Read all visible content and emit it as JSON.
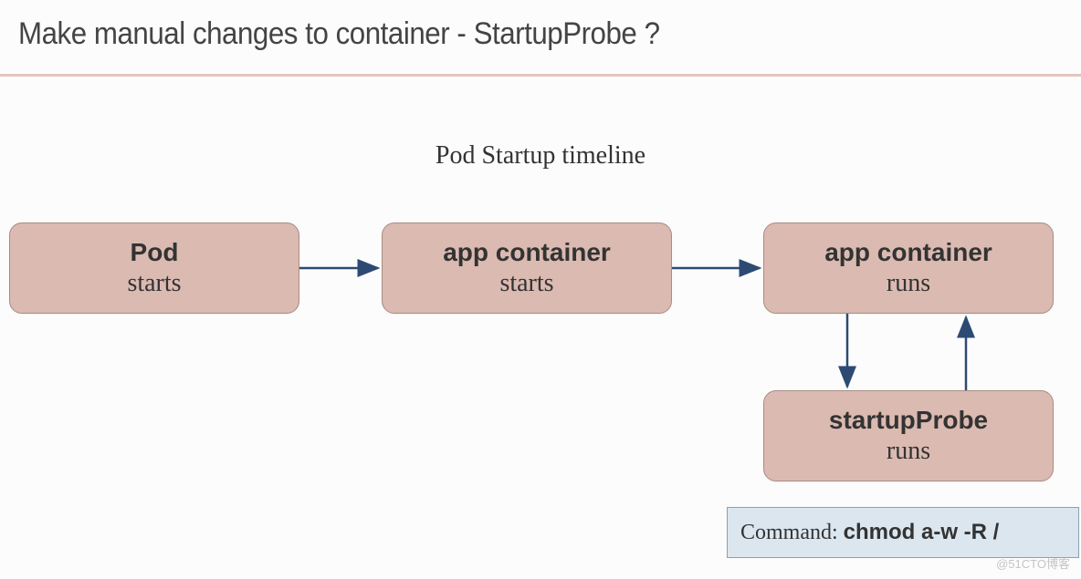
{
  "header": {
    "title": "Make manual changes to container - StartupProbe ?"
  },
  "subtitle": "Pod Startup timeline",
  "boxes": {
    "pod": {
      "title": "Pod",
      "sub": "starts"
    },
    "app1": {
      "title": "app container",
      "sub": "starts"
    },
    "app2": {
      "title": "app container",
      "sub": "runs"
    },
    "probe": {
      "title": "startupProbe",
      "sub": "runs"
    }
  },
  "command": {
    "label": "Command:",
    "value": "chmod a-w -R /"
  },
  "watermark": "@51CTO博客",
  "chart_data": {
    "type": "diagram",
    "title": "Pod Startup timeline",
    "nodes": [
      {
        "id": "pod",
        "title": "Pod",
        "subtitle": "starts"
      },
      {
        "id": "app1",
        "title": "app container",
        "subtitle": "starts"
      },
      {
        "id": "app2",
        "title": "app container",
        "subtitle": "runs"
      },
      {
        "id": "probe",
        "title": "startupProbe",
        "subtitle": "runs",
        "command": "chmod a-w -R /"
      }
    ],
    "edges": [
      {
        "from": "pod",
        "to": "app1"
      },
      {
        "from": "app1",
        "to": "app2"
      },
      {
        "from": "app2",
        "to": "probe"
      },
      {
        "from": "probe",
        "to": "app2"
      }
    ]
  }
}
